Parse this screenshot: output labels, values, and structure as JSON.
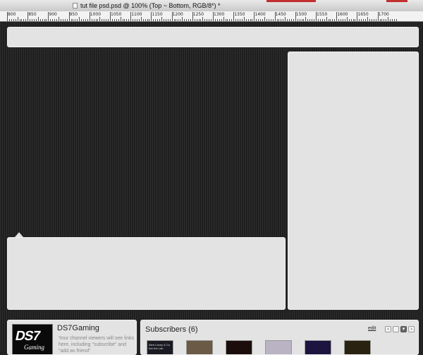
{
  "window": {
    "title": "tut file psd.psd @ 100% (Top ~ Bottom, RGB/8*) *"
  },
  "ruler": {
    "labels": [
      "800",
      "850",
      "900",
      "950",
      "1000",
      "1050",
      "1100",
      "1150",
      "1200",
      "1250",
      "1300",
      "1350",
      "1400",
      "1450",
      "1500",
      "1550",
      "1600",
      "1650",
      "1700"
    ]
  },
  "profile": {
    "avatar_logo": "DS7",
    "avatar_sub": "Gaming",
    "channel_name": "DS7Gaming",
    "description": "Your channel viewers will see links here, including \"subscribe\" and \"add as friend\""
  },
  "subscribers": {
    "title": "Subscribers (6)",
    "edit_label": "edit",
    "prev_icon": "‹",
    "dropdown_icon": "▾",
    "next_icon": "›",
    "thumbs": [
      {
        "label": "Alert Lacey & Co live the Lab",
        "color": "#1a1a22"
      },
      {
        "label": "",
        "color": "#6a5a46"
      },
      {
        "label": "",
        "color": "#1c0d0d"
      },
      {
        "label": "",
        "color": "#b9b3c4"
      },
      {
        "label": "",
        "color": "#1d1440"
      },
      {
        "label": "",
        "color": "#2a2210"
      }
    ]
  },
  "colors": {
    "panel": "#e3e3e3",
    "canvas": "#262626",
    "titlebar_accent": "#c23030"
  }
}
